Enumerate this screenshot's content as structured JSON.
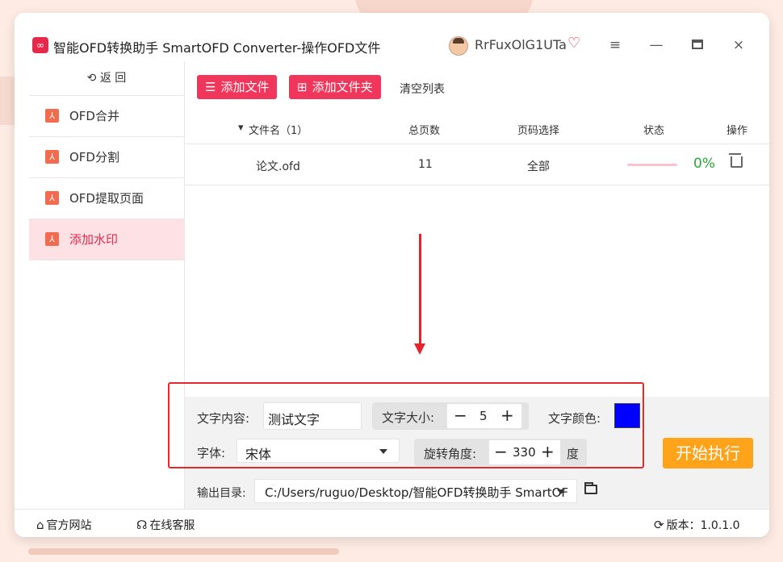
{
  "app": {
    "title": "智能OFD转换助手 SmartOFD Converter-操作OFD文件",
    "username": "RrFuxOlG1UTa",
    "logo_glyph": "∞"
  },
  "window_controls": {
    "menu": "≡",
    "minimize": "—",
    "close": "×"
  },
  "sidebar": {
    "back_label": "返 回",
    "back_icon": "⟲",
    "items": [
      {
        "label": "OFD合并",
        "icon": "pdf-icon"
      },
      {
        "label": "OFD分割",
        "icon": "pdf-icon"
      },
      {
        "label": "OFD提取页面",
        "icon": "pdf-icon"
      },
      {
        "label": "添加水印",
        "icon": "pdf-icon",
        "active": true
      }
    ]
  },
  "toolbar": {
    "add_file": "添加文件",
    "add_folder": "添加文件夹",
    "clear_list": "清空列表"
  },
  "table": {
    "headers": [
      "文件名（1）",
      "总页数",
      "页码选择",
      "状态",
      "操作"
    ],
    "rows": [
      {
        "filename": "论文.ofd",
        "pages": "11",
        "page_selection": "全部",
        "progress": "0%",
        "progress_value": 0
      }
    ]
  },
  "watermark": {
    "text_label": "文字内容:",
    "text_value": "测试文字",
    "size_label": "文字大小:",
    "size_value": "5",
    "color_label": "文字颜色:",
    "color_value": "#0000ff",
    "font_label": "字体:",
    "font_value": "宋体",
    "angle_label": "旋转角度:",
    "angle_value": "330",
    "angle_unit": "度",
    "minus": "−",
    "plus": "+"
  },
  "output": {
    "label": "输出目录:",
    "path": "C:/Users/ruguo/Desktop/智能OFD转换助手 SmartOF"
  },
  "start_button": "开始执行",
  "footer": {
    "website": "官方网站",
    "support": "在线客服",
    "version_label": "版本：",
    "version": "1.0.1.0"
  },
  "colors": {
    "accent": "#f0365a",
    "start": "#ffa31a",
    "success": "#2aa838",
    "highlight_box": "#e42a2a"
  }
}
